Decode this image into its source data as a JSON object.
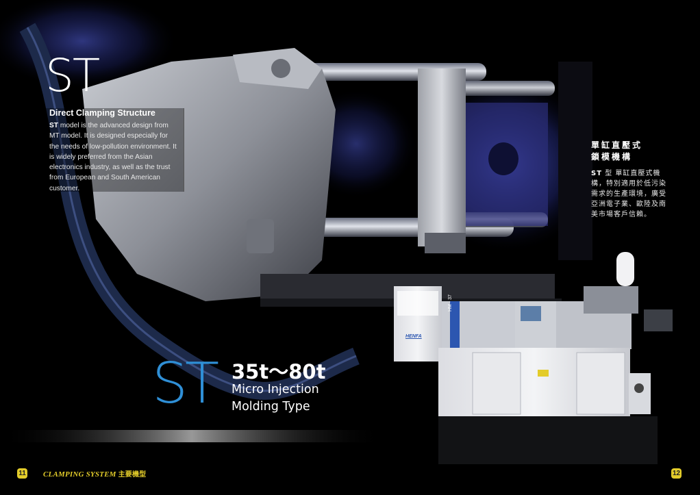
{
  "hero": {
    "brand": "ST"
  },
  "intro": {
    "heading": "Direct Clamping Structure",
    "model": "ST",
    "body": " model is the advanced design from MT model. It is designed especially for the needs of low-pollution environment. It is widely preferred from the Asian electronics industry, as well as the trust from European and South American customer."
  },
  "chinese": {
    "heading_line1": "單缸直壓式",
    "heading_line2": "鎖模機構",
    "model": "ST",
    "body": " 型 單缸直壓式機構，特別適用於低污染需求的生產環境，廣受亞洲電子業、歐陸及南美市場客戶信賴。"
  },
  "product": {
    "brand": "ST",
    "tonnage": "35t～80t",
    "type_line1": "Micro Injection",
    "type_line2": "Molding Type"
  },
  "machine": {
    "side_label": "HM - 37",
    "logo": "HENFA"
  },
  "footer": {
    "page_left": "11",
    "page_right": "12",
    "section_en": "CLAMPING SYSTEM",
    "section_cn": "主要機型"
  },
  "colors": {
    "accent_blue": "#2f8fd6",
    "accent_yellow": "#e3cc2a",
    "background": "#000000"
  }
}
